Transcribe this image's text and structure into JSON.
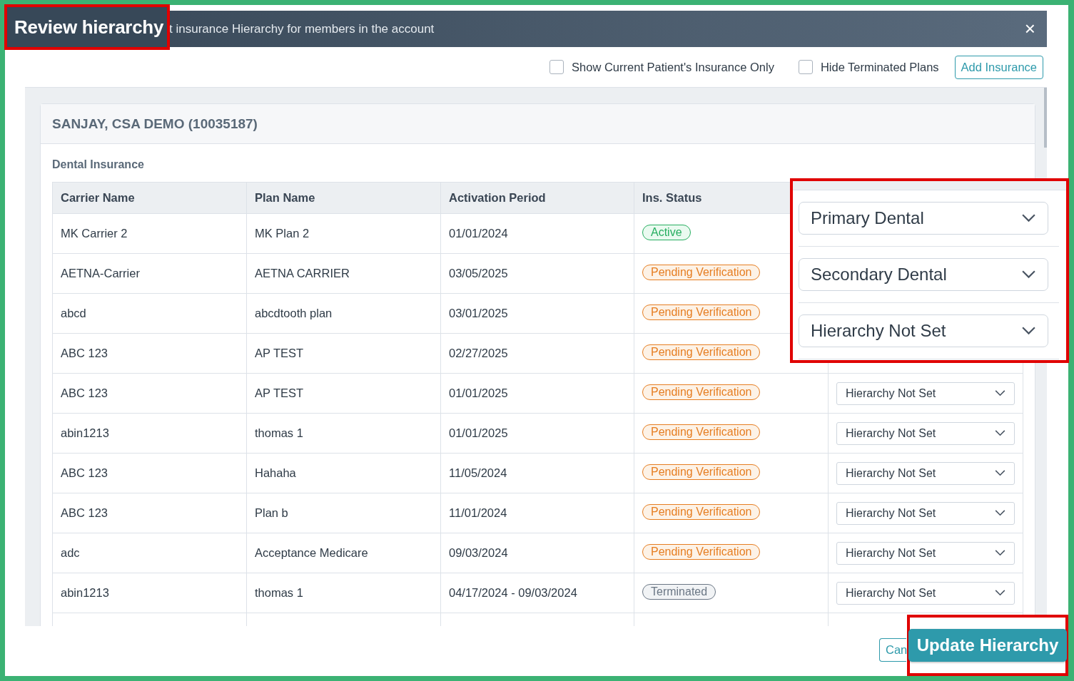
{
  "dialog": {
    "subtitle": "t insurance Hierarchy for members in the account",
    "close": "×"
  },
  "filters": [
    {
      "label": "Show Current Patient's Insurance Only",
      "checked": false
    },
    {
      "label": "Hide Terminated Plans",
      "checked": false
    }
  ],
  "add_button": "Add Insurance",
  "member": "SANJAY, CSA DEMO (10035187)",
  "section": "Dental Insurance",
  "table": {
    "columns": [
      "Carrier Name",
      "Plan Name",
      "Activation Period",
      "Ins. Status"
    ],
    "rows": [
      {
        "carrier": "MK Carrier 2",
        "plan": "MK Plan 2",
        "period": "01/01/2024",
        "status": {
          "label": "Active",
          "kind": "active"
        }
      },
      {
        "carrier": "AETNA-Carrier",
        "plan": "AETNA CARRIER",
        "period": "03/05/2025",
        "status": {
          "label": "Pending Verification",
          "kind": "pending"
        }
      },
      {
        "carrier": "abcd",
        "plan": "abcdtooth plan",
        "period": "03/01/2025",
        "status": {
          "label": "Pending Verification",
          "kind": "pending"
        }
      },
      {
        "carrier": "ABC 123",
        "plan": "AP TEST",
        "period": "02/27/2025",
        "status": {
          "label": "Pending Verification",
          "kind": "pending"
        }
      },
      {
        "carrier": "ABC 123",
        "plan": "AP TEST",
        "period": "01/01/2025",
        "status": {
          "label": "Pending Verification",
          "kind": "pending"
        },
        "hierarchy": "Hierarchy Not Set"
      },
      {
        "carrier": "abin1213",
        "plan": "thomas 1",
        "period": "01/01/2025",
        "status": {
          "label": "Pending Verification",
          "kind": "pending"
        },
        "hierarchy": "Hierarchy Not Set"
      },
      {
        "carrier": "ABC 123",
        "plan": "Hahaha",
        "period": "11/05/2024",
        "status": {
          "label": "Pending Verification",
          "kind": "pending"
        },
        "hierarchy": "Hierarchy Not Set"
      },
      {
        "carrier": "ABC 123",
        "plan": "Plan b",
        "period": "11/01/2024",
        "status": {
          "label": "Pending Verification",
          "kind": "pending"
        },
        "hierarchy": "Hierarchy Not Set"
      },
      {
        "carrier": "adc",
        "plan": "Acceptance Medicare",
        "period": "09/03/2024",
        "status": {
          "label": "Pending Verification",
          "kind": "pending"
        },
        "hierarchy": "Hierarchy Not Set"
      },
      {
        "carrier": "abin1213",
        "plan": "thomas 1",
        "period": "04/17/2024 - 09/03/2024",
        "status": {
          "label": "Terminated",
          "kind": "terminated"
        },
        "hierarchy": "Hierarchy Not Set"
      }
    ]
  },
  "cancel_button": "Can",
  "callouts": {
    "title": "Review hierarchy",
    "hierarchy_selects": [
      "Primary Dental",
      "Secondary Dental",
      "Hierarchy Not Set"
    ],
    "update_button": "Update Hierarchy"
  }
}
